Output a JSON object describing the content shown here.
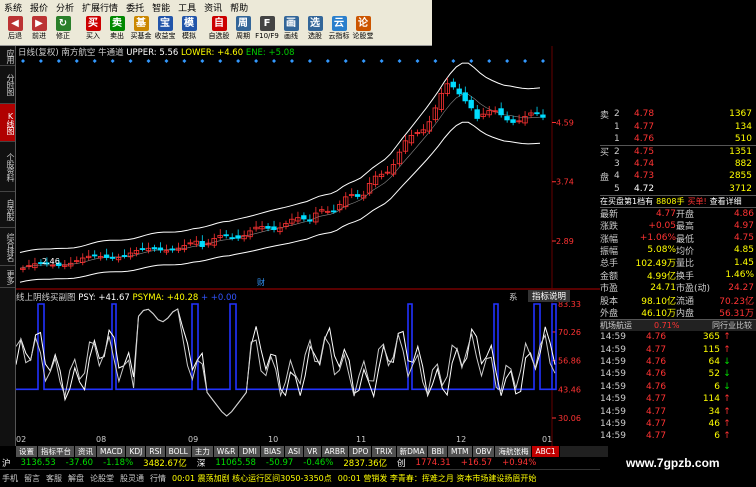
{
  "menu": [
    "系统",
    "报价",
    "分析",
    "扩展行情",
    "委托",
    "智能",
    "工具",
    "资讯",
    "帮助"
  ],
  "toolbar": [
    {
      "label": "后退",
      "icon": "back-arrow-icon",
      "color": "#bb3333",
      "glyph": "◀"
    },
    {
      "label": "前进",
      "icon": "forward-arrow-icon",
      "color": "#bb3333",
      "glyph": "▶"
    },
    {
      "label": "修正",
      "icon": "refresh-icon",
      "color": "#2a7f2a",
      "glyph": "↻"
    },
    {
      "label": "买入",
      "icon": "buy-icon",
      "color": "#cc0000",
      "glyph": "买"
    },
    {
      "label": "卖出",
      "icon": "sell-icon",
      "color": "#008800",
      "glyph": "卖"
    },
    {
      "label": "买基金",
      "icon": "fund-icon",
      "color": "#cc8800",
      "glyph": "基"
    },
    {
      "label": "收益宝",
      "icon": "profit-icon",
      "color": "#2255aa",
      "glyph": "宝"
    },
    {
      "label": "模拟",
      "icon": "simulate-icon",
      "color": "#2255aa",
      "glyph": "模"
    },
    {
      "label": "自选股",
      "icon": "watchlist-icon",
      "color": "#cc0000",
      "glyph": "自"
    },
    {
      "label": "周期",
      "icon": "period-icon",
      "color": "#336699",
      "glyph": "周"
    },
    {
      "label": "F10/F9",
      "icon": "f10-icon",
      "color": "#444",
      "glyph": "F"
    },
    {
      "label": "画线",
      "icon": "draw-icon",
      "color": "#336699",
      "glyph": "画"
    },
    {
      "label": "选股",
      "icon": "select-icon",
      "color": "#336699",
      "glyph": "选"
    },
    {
      "label": "云指标",
      "icon": "cloud-icon",
      "color": "#2a7fcc",
      "glyph": "云"
    },
    {
      "label": "论股堂",
      "icon": "forum-icon",
      "color": "#cc5500",
      "glyph": "论"
    }
  ],
  "sidebar": [
    "应用",
    "分时图",
    "K线图",
    "个股资料",
    "自选股",
    "综合排名",
    "更多"
  ],
  "main_chart": {
    "title": "日线(复权)",
    "name": "南方航空",
    "indicator": "牛通道",
    "upper": "UPPER: 5.56",
    "lower": "LOWER: +4.60",
    "ene": "ENE: +5.08",
    "ylabels": [
      "4.59",
      "3.74",
      "2.89"
    ],
    "low_label": "2.46",
    "mark_label": "财"
  },
  "sub_chart": {
    "title": "线上阴线买副图",
    "psy": "PSY: +41.67",
    "psyma": "PSYMA: +40.28",
    "extra": "+ +0.00",
    "ylabels": [
      "83.33",
      "70.26",
      "56.86",
      "43.46",
      "30.06"
    ],
    "tab_left": "系",
    "tab_right": "指标说明"
  },
  "dates": [
    "08",
    "09",
    "10",
    "11",
    "12",
    "01",
    "02"
  ],
  "bottom_tabs": [
    "设置",
    "指标平台",
    "资讯",
    "MACD",
    "KDJ",
    "RSI",
    "BOLL",
    "主力",
    "W&R",
    "DMI",
    "BIAS",
    "ASI",
    "VR",
    "ARBR",
    "DPO",
    "TRIX",
    "新DMA",
    "BBI",
    "MTM",
    "OBV",
    "海航张梅",
    "ABC1"
  ],
  "orderbook": [
    {
      "side": "卖",
      "level": "2",
      "price": "4.78",
      "vol": "1367"
    },
    {
      "side": "",
      "level": "1",
      "price": "4.77",
      "vol": "134"
    },
    {
      "side": "",
      "level": "1",
      "price": "4.76",
      "vol": "510"
    },
    {
      "side": "买",
      "level": "2",
      "price": "4.75",
      "vol": "1351"
    },
    {
      "side": "",
      "level": "3",
      "price": "4.74",
      "vol": "882"
    },
    {
      "side": "盘",
      "level": "4",
      "price": "4.73",
      "vol": "2855"
    },
    {
      "side": "",
      "level": "5",
      "price": "4.72",
      "vol": "3712"
    }
  ],
  "pending": {
    "label": "在买盘第1档有",
    "vol": "8808手",
    "action": "买单!",
    "detail": "查看详细"
  },
  "quote": [
    [
      "最新",
      "4.77",
      "开盘",
      "4.86"
    ],
    [
      "涨跌",
      "+0.05",
      "最高",
      "4.97"
    ],
    [
      "涨幅",
      "+1.06%",
      "最低",
      "4.75"
    ],
    [
      "振幅",
      "5.08%",
      "均价",
      "4.85"
    ],
    [
      "总手",
      "102.49万",
      "量比",
      "1.45"
    ],
    [
      "金额",
      "4.99亿",
      "换手",
      "1.46%"
    ],
    [
      "市盈",
      "24.71",
      "市盈(动)",
      "24.27"
    ],
    [
      "股本",
      "98.10亿",
      "流通",
      "70.23亿"
    ],
    [
      "外盘",
      "46.10万",
      "内盘",
      "56.31万"
    ]
  ],
  "org": {
    "label": "机场航运",
    "pct": "0.71%",
    "tab": "同行业比较"
  },
  "ticks": [
    [
      "14:59",
      "4.76",
      "365",
      "up"
    ],
    [
      "14:59",
      "4.77",
      "115",
      "up"
    ],
    [
      "14:59",
      "4.76",
      "64",
      "dn"
    ],
    [
      "14:59",
      "4.76",
      "52",
      "dn"
    ],
    [
      "14:59",
      "4.76",
      "6",
      "dn"
    ],
    [
      "14:59",
      "4.77",
      "114",
      "up"
    ],
    [
      "14:59",
      "4.77",
      "34",
      "up"
    ],
    [
      "14:59",
      "4.77",
      "46",
      "up"
    ],
    [
      "14:59",
      "4.77",
      "6",
      "up"
    ]
  ],
  "index_bar": [
    {
      "name": "沪",
      "val": "3136.53",
      "chg": "-37.60",
      "pct": "-1.18%"
    },
    {
      "name": "",
      "val": "3482.67亿",
      "chg": "",
      "pct": ""
    },
    {
      "name": "深",
      "val": "11065.58",
      "chg": "-50.97",
      "pct": "-0.46%"
    },
    {
      "name": "",
      "val": "2837.36亿",
      "chg": "",
      "pct": ""
    },
    {
      "name": "创",
      "val": "1774.31",
      "chg": "+16.57",
      "pct": "+0.94%"
    }
  ],
  "status": [
    "手机",
    "留言",
    "客服",
    "解盘",
    "论股堂",
    "股灵通",
    "行情",
    "00:01 震荡加剧 核心运行区间3050-3350点",
    "00:01 营销发 李青春：挥难之月 资本市场建设扬眉开始"
  ],
  "watermark": "www.7gpzb.com",
  "chart_data": {
    "type": "line",
    "title": "日线(复权) 南方航空",
    "series": [
      {
        "name": "UPPER",
        "last": 5.56
      },
      {
        "name": "LOWER",
        "last": 4.6
      },
      {
        "name": "ENE",
        "last": 5.08
      },
      {
        "name": "PSY",
        "last": 41.67
      },
      {
        "name": "PSYMA",
        "last": 40.28
      }
    ],
    "ylim_main": [
      2.46,
      5.4
    ],
    "ylim_sub": [
      30.06,
      83.33
    ]
  }
}
